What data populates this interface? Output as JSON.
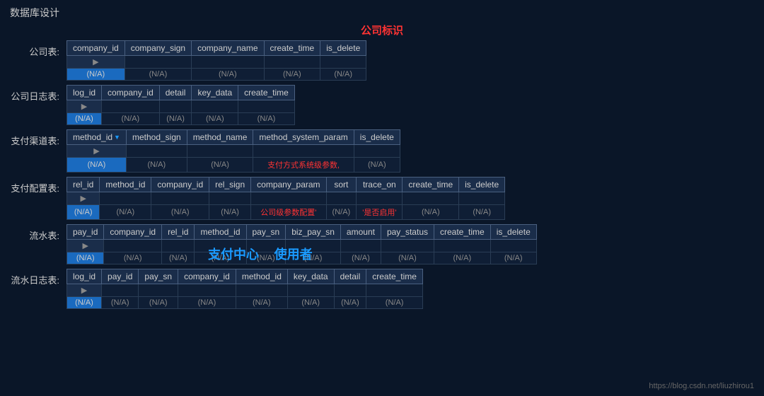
{
  "page": {
    "title": "数据库设计",
    "center_title": "公司标识",
    "bottom_url": "https://blog.csdn.net/liuzhirou1"
  },
  "tables": {
    "company": {
      "label": "公司表:",
      "columns": [
        "company_id",
        "company_sign",
        "company_name",
        "create_time",
        "is_delete"
      ],
      "row": [
        "(N/A)",
        "(N/A)",
        "(N/A)",
        "(N/A)",
        "(N/A)"
      ]
    },
    "company_log": {
      "label": "公司日志表:",
      "columns": [
        "log_id",
        "company_id",
        "detail",
        "key_data",
        "create_time"
      ],
      "row": [
        "(N/A)",
        "(N/A)",
        "(N/A)",
        "(N/A)",
        "(N/A)"
      ]
    },
    "payment_channel": {
      "label": "支付渠道表:",
      "columns": [
        "method_id",
        "method_sign",
        "method_name",
        "method_system_param",
        "is_delete"
      ],
      "row_special": [
        "(N/A)",
        "(N/A)",
        "(N/A)",
        "支付方式系统级参数,",
        "(N/A)"
      ]
    },
    "payment_config": {
      "label": "支付配置表:",
      "columns": [
        "rel_id",
        "method_id",
        "company_id",
        "rel_sign",
        "company_param",
        "sort",
        "trace_on",
        "create_time",
        "is_delete"
      ],
      "row_special": [
        "(N/A)",
        "(N/A)",
        "(N/A)",
        "(N/A)",
        "公司级参数配置'",
        "(N/A)",
        "'是否启用'",
        "(N/A)",
        "(N/A)"
      ]
    },
    "transaction": {
      "label": "流水表:",
      "columns": [
        "pay_id",
        "company_id",
        "rel_id",
        "method_id",
        "pay_sn",
        "biz_pay_sn",
        "amount",
        "pay_status",
        "create_time",
        "is_delete"
      ],
      "row": [
        "(N/A)",
        "(N/A)",
        "(N/A)",
        "(N/A)",
        "(N/A)",
        "(N/A)",
        "(N/A)",
        "(N/A)",
        "(N/A)",
        "(N/A)"
      ],
      "overlay_left": "支付中心",
      "overlay_right": "使用者"
    },
    "transaction_log": {
      "label": "流水日志表:",
      "columns": [
        "log_id",
        "pay_id",
        "pay_sn",
        "company_id",
        "method_id",
        "key_data",
        "detail",
        "create_time"
      ],
      "row": [
        "(N/A)",
        "(N/A)",
        "(N/A)",
        "(N/A)",
        "(N/A)",
        "(N/A)",
        "(N/A)",
        "(N/A)"
      ]
    }
  }
}
